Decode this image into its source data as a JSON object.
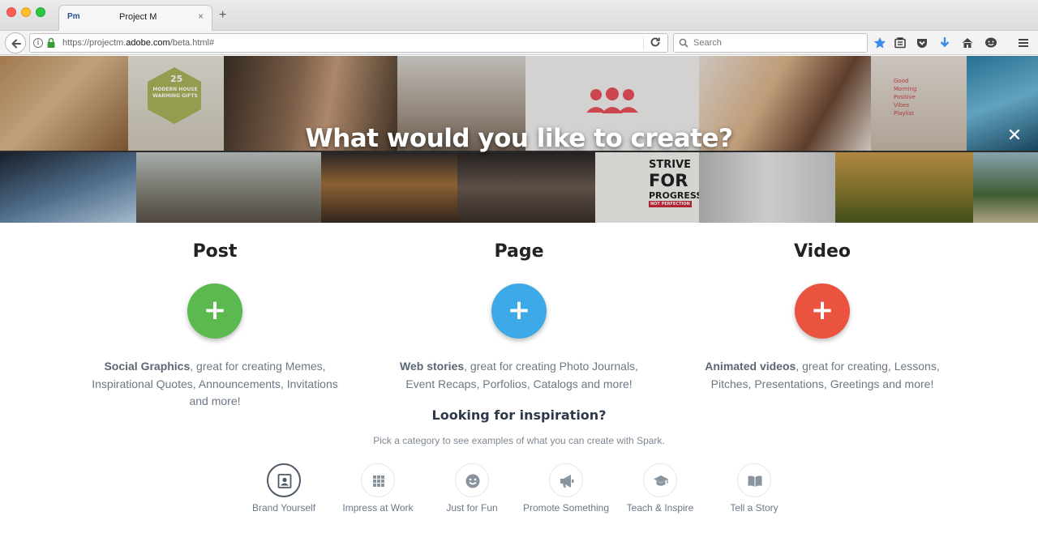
{
  "browser": {
    "tab_favicon": "Pm",
    "tab_title": "Project M",
    "tab_close": "×",
    "new_tab": "+",
    "url_prefix": "https://projectm.",
    "url_domain": "adobe.com",
    "url_suffix": "/beta.html#",
    "search_placeholder": "Search",
    "icons": [
      "back-icon",
      "info-icon",
      "lock-icon",
      "reload-icon",
      "search-icon",
      "bookmark-star-icon",
      "reading-list-icon",
      "pocket-icon",
      "download-icon",
      "home-icon",
      "chat-icon",
      "menu-icon"
    ]
  },
  "hero": {
    "title": "What would you like to create?",
    "close": "✕",
    "tile_texts": {
      "modern_house_number": "25",
      "modern_house": "MODERN HOUSE WARMING GIFTS",
      "good_morning": "Good Morning Positive Vibes Playlist",
      "strive": "STRIVE",
      "for": "FOR",
      "progress": "PROGRESS",
      "not_perfection": "NOT PERFECTION"
    }
  },
  "options": [
    {
      "title": "Post",
      "color": "#5cb94f",
      "bold": "Social Graphics",
      "desc": ", great for creating Memes, Inspirational Quotes, Announcements, Invitations and more!"
    },
    {
      "title": "Page",
      "color": "#3da9e6",
      "bold": "Web stories",
      "desc": ", great for creating Photo Journals, Event Recaps, Porfolios, Catalogs and more!"
    },
    {
      "title": "Video",
      "color": "#e9533f",
      "bold": "Animated videos",
      "desc": ", great for creating, Lessons, Pitches, Presentations, Greetings and more!"
    }
  ],
  "plus_symbol": "+",
  "inspiration": {
    "title": "Looking for inspiration?",
    "subtitle": "Pick a category to see examples of what you can create with Spark.",
    "categories": [
      {
        "label": "Brand Yourself",
        "icon": "portrait-icon",
        "active": true
      },
      {
        "label": "Impress at Work",
        "icon": "building-icon",
        "active": false
      },
      {
        "label": "Just for Fun",
        "icon": "smiley-icon",
        "active": false
      },
      {
        "label": "Promote Something",
        "icon": "megaphone-icon",
        "active": false
      },
      {
        "label": "Teach & Inspire",
        "icon": "graduation-cap-icon",
        "active": false
      },
      {
        "label": "Tell a Story",
        "icon": "book-icon",
        "active": false
      }
    ]
  }
}
